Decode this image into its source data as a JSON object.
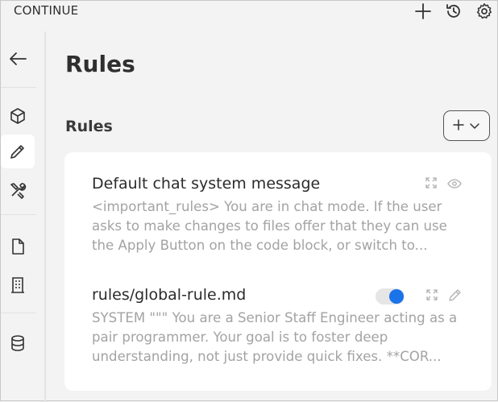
{
  "app": {
    "title": "CONTINUE"
  },
  "header": {
    "title": "Rules"
  },
  "section": {
    "title": "Rules"
  },
  "rules": [
    {
      "name": "Default chat system message",
      "preview": "<important_rules> You are in chat mode. If the user asks to make changes to files offer that they can use the Apply Button on the code block, or switch to..."
    },
    {
      "name": "rules/global-rule.md",
      "preview": "SYSTEM \"\"\" You are a Senior Staff Engineer acting as a pair programmer. Your goal is to foster deep understanding, not just provide quick fixes. **COR...",
      "enabled": true
    }
  ],
  "colors": {
    "toggle_on": "#1a73e8",
    "card_bg": "#ffffff",
    "page_bg": "#f3f3f3"
  }
}
